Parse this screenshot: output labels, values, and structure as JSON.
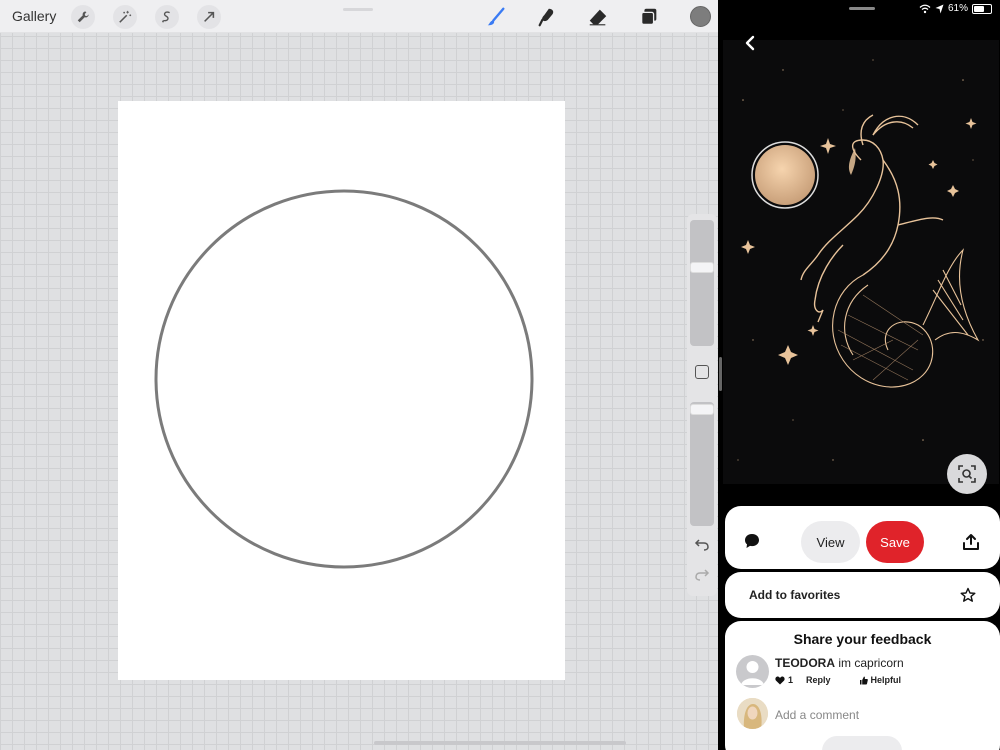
{
  "procreate": {
    "gallery_label": "Gallery",
    "tools_left": [
      "wrench-icon",
      "magic-wand-icon",
      "selection-icon",
      "transform-arrow-icon"
    ],
    "tools_right": [
      "brush-icon",
      "smudge-icon",
      "eraser-icon",
      "layers-icon"
    ],
    "accent_color": "#3a7bf4",
    "current_color": "#7d7d7d"
  },
  "pinterest": {
    "status": {
      "battery_percent": "61%",
      "battery_level": 0.61
    },
    "pin_actions": {
      "view_label": "View",
      "save_label": "Save"
    },
    "favorites_label": "Add to favorites",
    "feedback": {
      "title": "Share your feedback",
      "comment": {
        "author": "TEODORA",
        "text": "im capricorn",
        "likes": "1",
        "reply_label": "Reply",
        "helpful_label": "Helpful"
      },
      "add_comment_placeholder": "Add a comment"
    },
    "colors": {
      "save": "#e0232a",
      "artwork_gold": "#e8c39a"
    }
  }
}
